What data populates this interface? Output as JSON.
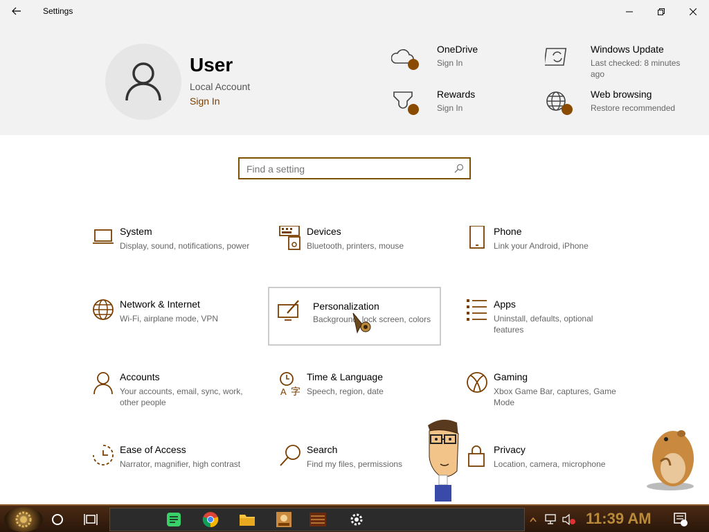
{
  "window": {
    "title": "Settings"
  },
  "header": {
    "user_name": "User",
    "account_type": "Local Account",
    "sign_in": "Sign In",
    "items": [
      {
        "title": "OneDrive",
        "subtitle": "Sign In",
        "icon": "cloud-icon"
      },
      {
        "title": "Windows Update",
        "subtitle": "Last checked: 8 minutes ago",
        "icon": "update-icon"
      },
      {
        "title": "Rewards",
        "subtitle": "Sign In",
        "icon": "trophy-icon"
      },
      {
        "title": "Web browsing",
        "subtitle": "Restore recommended",
        "icon": "globe-icon"
      }
    ]
  },
  "search": {
    "placeholder": "Find a setting"
  },
  "categories": [
    {
      "title": "System",
      "desc": "Display, sound, notifications, power",
      "icon": "laptop-icon"
    },
    {
      "title": "Devices",
      "desc": "Bluetooth, printers, mouse",
      "icon": "devices-icon"
    },
    {
      "title": "Phone",
      "desc": "Link your Android, iPhone",
      "icon": "phone-icon"
    },
    {
      "title": "Network & Internet",
      "desc": "Wi-Fi, airplane mode, VPN",
      "icon": "globe-icon"
    },
    {
      "title": "Personalization",
      "desc": "Background, lock screen, colors",
      "icon": "paint-icon"
    },
    {
      "title": "Apps",
      "desc": "Uninstall, defaults, optional features",
      "icon": "apps-list-icon"
    },
    {
      "title": "Accounts",
      "desc": "Your accounts, email, sync, work, other people",
      "icon": "person-icon"
    },
    {
      "title": "Time & Language",
      "desc": "Speech, region, date",
      "icon": "time-language-icon"
    },
    {
      "title": "Gaming",
      "desc": "Xbox Game Bar, captures, Game Mode",
      "icon": "xbox-icon"
    },
    {
      "title": "Ease of Access",
      "desc": "Narrator, magnifier, high contrast",
      "icon": "ease-of-access-icon"
    },
    {
      "title": "Search",
      "desc": "Find my files, permissions",
      "icon": "search-icon"
    },
    {
      "title": "Privacy",
      "desc": "Location, camera, microphone",
      "icon": "lock-icon"
    }
  ],
  "taskbar": {
    "clock": "11:39 AM"
  },
  "colors": {
    "accent": "#7a5200",
    "icon": "#7a3e00",
    "header_bg": "#f2f2f2"
  }
}
